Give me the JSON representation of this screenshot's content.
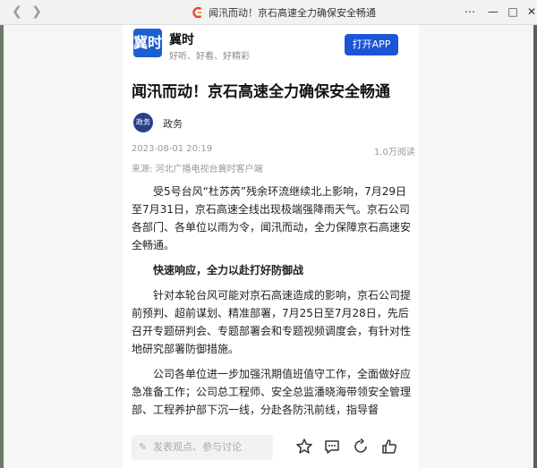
{
  "window": {
    "title": "闻汛而动！京石高速全力确保安全畅通"
  },
  "app": {
    "name": "冀时",
    "slogan": "好听、好看、好精彩",
    "logo_text": "冀时",
    "open_button": "打开APP"
  },
  "article": {
    "title": "闻汛而动！京石高速全力确保安全畅通",
    "author_avatar_text": "政务",
    "author": "政务",
    "date": "2023-08-01 20:19",
    "views": "1.0万阅读",
    "source": "来源: 河北广播电视台冀时客户端",
    "paragraphs": [
      "受5号台风“杜苏芮”残余环流继续北上影响，7月29日至7月31日，京石高速全线出现极端强降雨天气。京石公司各部门、各单位以雨为令，闻汛而动，全力保障京石高速安全畅通。",
      "快速响应，全力以赴打好防御战",
      "针对本轮台风可能对京石高速造成的影响，京石公司提前预判、超前谋划、精准部署，7月25日至7月28日，先后召开专题研判会、专题部署会和专题视频调度会，有针对性地研究部署防御措施。",
      "公司各单位进一步加强汛期值班值守工作，全面做好应急准备工作；公司总工程师、安全总监潘晓海带领安全管理部、工程养护部下沉一线，分赴各防汛前线，指导督"
    ]
  },
  "bottom": {
    "comment_placeholder": "发表观点、参与讨论"
  },
  "colors": {
    "accent": "#1c54d6",
    "logo_red": "#e8452c"
  }
}
